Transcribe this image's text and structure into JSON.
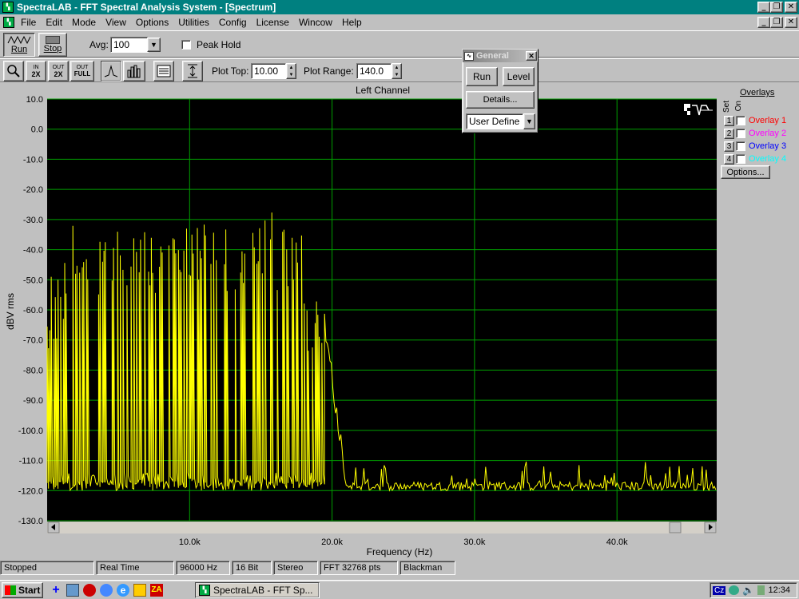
{
  "titlebar": {
    "title": "SpectraLAB - FFT Spectral Analysis System - [Spectrum]"
  },
  "menu": [
    "File",
    "Edit",
    "Mode",
    "View",
    "Options",
    "Utilities",
    "Config",
    "License",
    "Wincow",
    "Help"
  ],
  "toolbar": {
    "run_label": "Run",
    "stop_label": "Stop",
    "avg_label": "Avg:",
    "avg_value": "100",
    "peak_hold_label": "Peak Hold",
    "plot_top_label": "Plot Top:",
    "plot_top_value": "10.00",
    "plot_range_label": "Plot Range:",
    "plot_range_value": "140.0"
  },
  "zoom_buttons": [
    {
      "top": "IN",
      "bottom": "2X"
    },
    {
      "top": "OUT",
      "bottom": "2X"
    },
    {
      "top": "OUT",
      "bottom": "FULL"
    }
  ],
  "palette": {
    "title": "General",
    "run_label": "Run",
    "level_label": "Level",
    "details_label": "Details...",
    "select_value": "User Define"
  },
  "overlays": {
    "title": "Overlays",
    "set_label": "Set",
    "on_label": "On",
    "items": [
      {
        "num": "1",
        "label": "Overlay 1",
        "color": "#ff0000"
      },
      {
        "num": "2",
        "label": "Overlay 2",
        "color": "#ff00ff"
      },
      {
        "num": "3",
        "label": "Overlay 3",
        "color": "#0000ff"
      },
      {
        "num": "4",
        "label": "Overlay 4",
        "color": "#00ffff"
      }
    ],
    "options_label": "Options..."
  },
  "chart_data": {
    "type": "line",
    "title": "Left Channel",
    "xlabel": "Frequency (Hz)",
    "ylabel": "dBV rms",
    "xlim": [
      0,
      47000
    ],
    "ylim": [
      -130,
      10
    ],
    "yticks": [
      10,
      0,
      -10,
      -20,
      -30,
      -40,
      -50,
      -60,
      -70,
      -80,
      -90,
      -100,
      -110,
      -120,
      -130
    ],
    "ytick_labels": [
      "10.0",
      "0.0",
      "-10.0",
      "-20.0",
      "-30.0",
      "-40.0",
      "-50.0",
      "-60.0",
      "-70.0",
      "-80.0",
      "-90.0",
      "-100.0",
      "-110.0",
      "-120.0",
      "-130.0"
    ],
    "xticks": [
      10000,
      20000,
      30000,
      40000
    ],
    "xtick_labels": [
      "10.0k",
      "20.0k",
      "30.0k",
      "40.0k"
    ],
    "series": [
      {
        "color": "#ffff00"
      }
    ],
    "background": "#000000",
    "grid_color": "#00a000",
    "grid": true
  },
  "status": [
    "Stopped",
    "Real Time",
    "96000 Hz",
    "16 Bit",
    "Stereo",
    "FFT 32768 pts",
    "Blackman"
  ],
  "taskbar": {
    "start_label": "Start",
    "task_label": "SpectraLAB - FFT Sp...",
    "lang": "Cz",
    "clock": "12:34"
  }
}
